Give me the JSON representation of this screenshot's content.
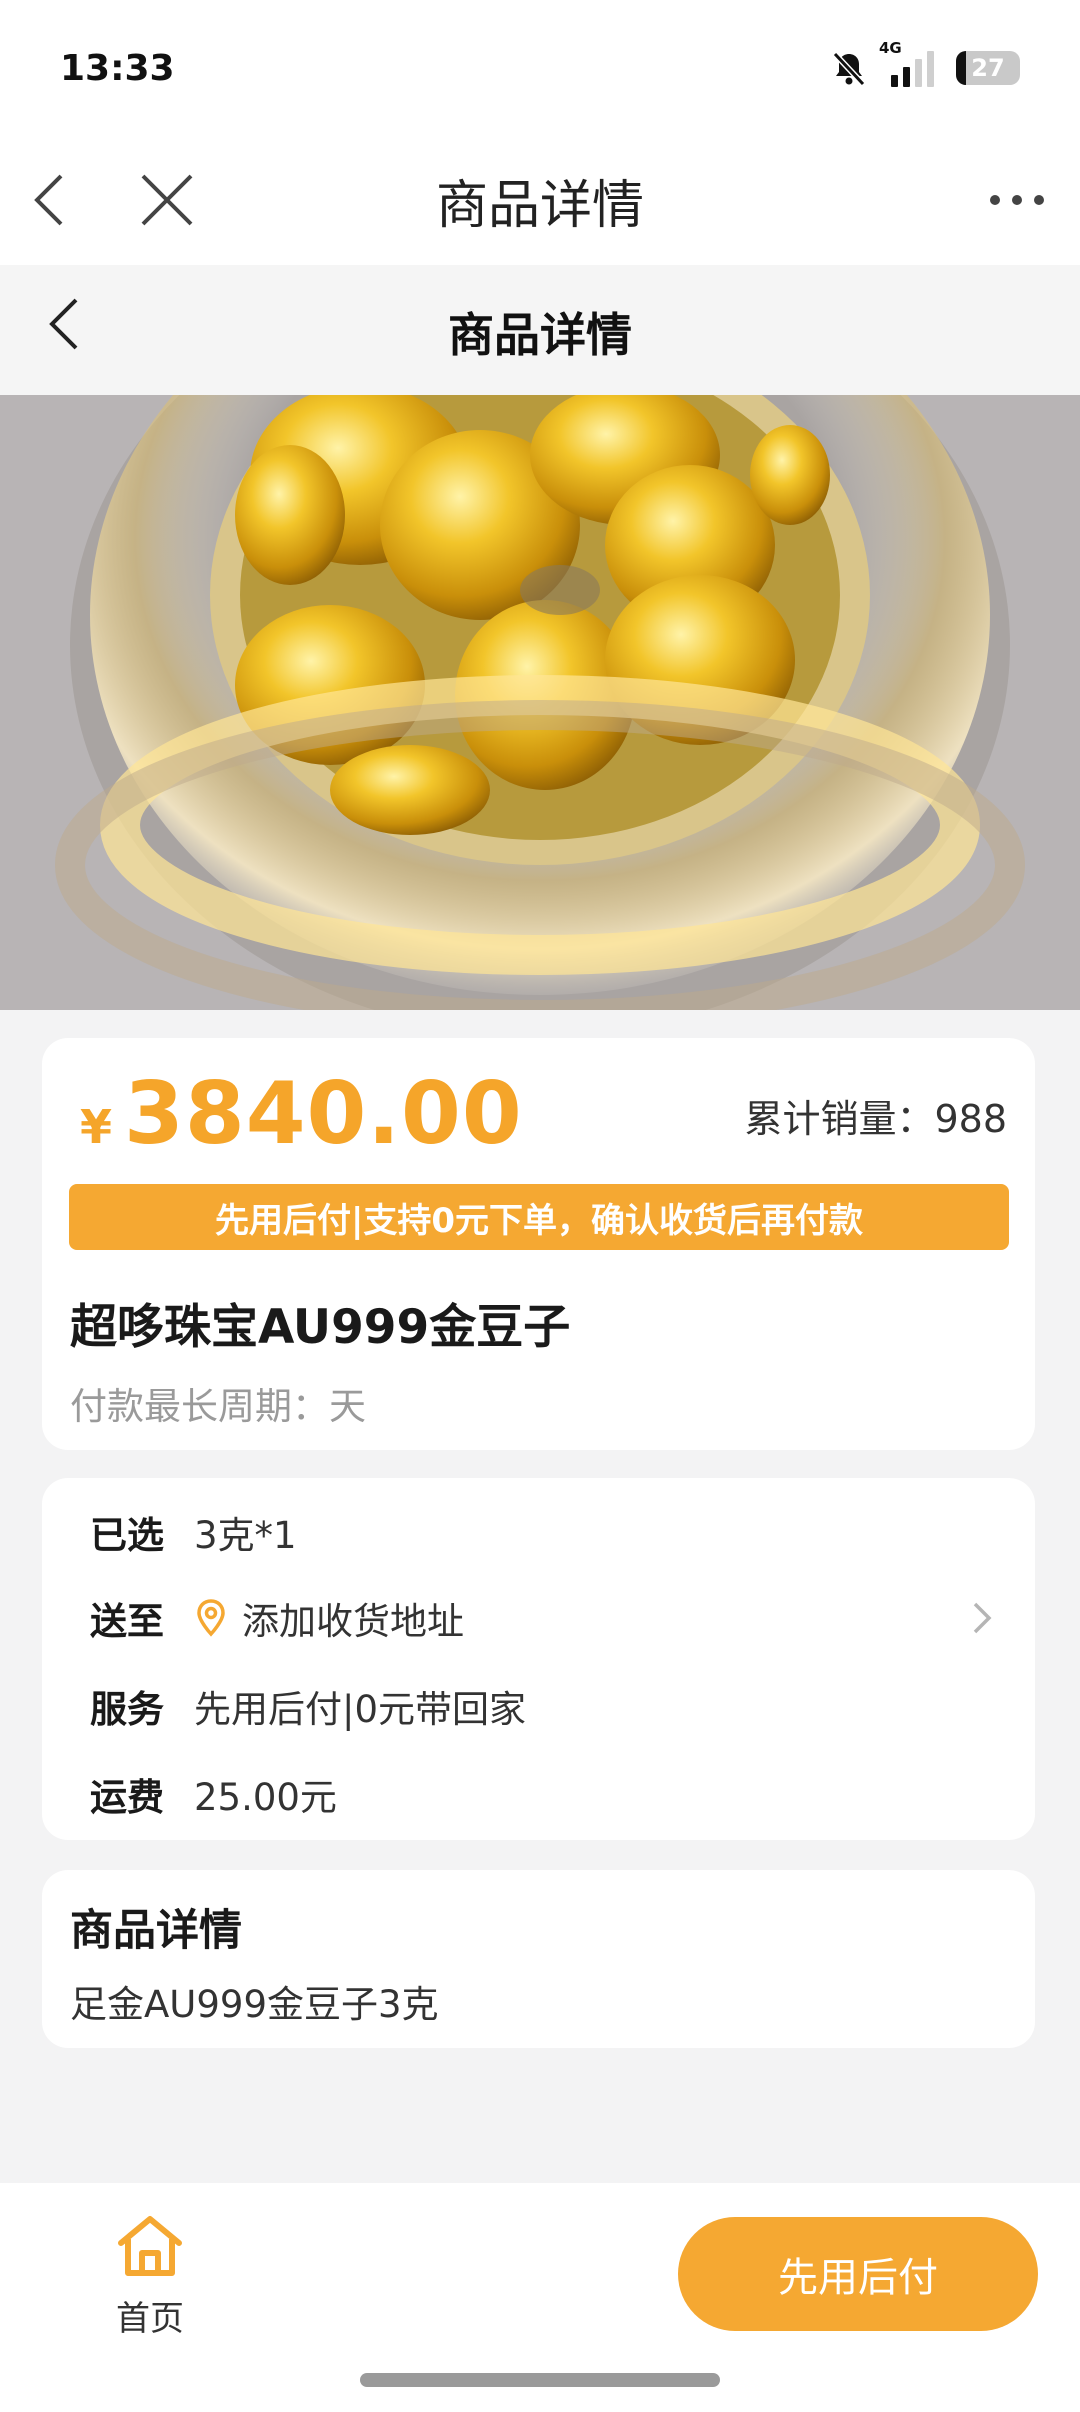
{
  "status_bar": {
    "time": "13:33",
    "network": "4G",
    "battery": "27"
  },
  "browser": {
    "title": "商品详情"
  },
  "page_header": {
    "title": "商品详情"
  },
  "price_card": {
    "currency": "¥",
    "price": "3840.00",
    "sales": "累计销量：988",
    "promo": "先用后付|支持0元下单，确认收货后再付款",
    "product_name": "超哆珠宝AU999金豆子",
    "pay_period": "付款最长周期：天"
  },
  "options": [
    {
      "label": "已选",
      "value": "3克*1"
    },
    {
      "label": "送至",
      "value": "添加收货地址"
    },
    {
      "label": "服务",
      "value": "先用后付|0元带回家"
    },
    {
      "label": "运费",
      "value": "25.00元"
    }
  ],
  "detail": {
    "title": "商品详情",
    "text": "足金AU999金豆子3克"
  },
  "bottom_bar": {
    "home_label": "首页",
    "pay_button": "先用后付"
  },
  "colors": {
    "accent": "#f5a832",
    "price": "#f5a52a",
    "background": "#f3f3f4"
  }
}
